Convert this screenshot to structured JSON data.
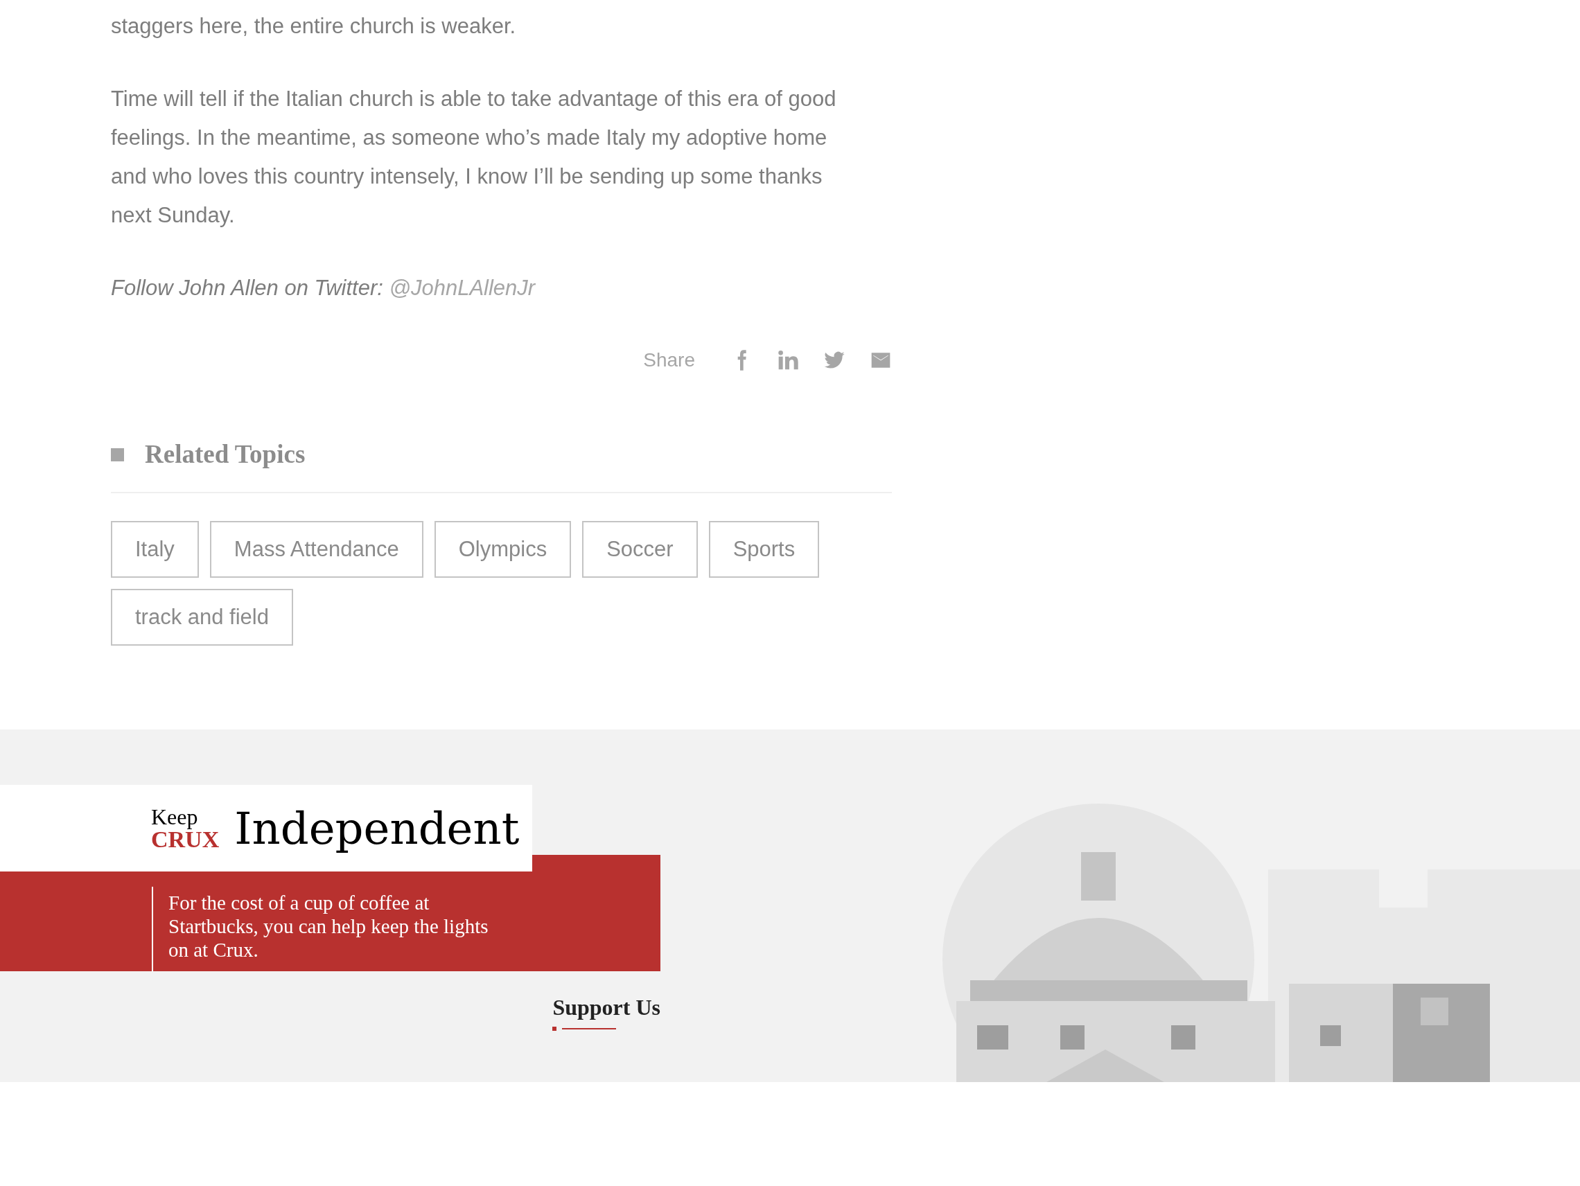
{
  "article": {
    "paragraphs": [
      "staggers here, the entire church is weaker.",
      "Time will tell if the Italian church is able to take advantage of this era of good feelings. In the meantime, as someone who’s made Italy my adoptive home and who loves this country intensely, I know I’ll be sending up some thanks next Sunday."
    ],
    "follow": {
      "text": "Follow John Allen on Twitter:",
      "handle": "@JohnLAllenJr"
    }
  },
  "share": {
    "label": "Share"
  },
  "related_topics": {
    "title": "Related Topics",
    "tags": [
      "Italy",
      "Mass Attendance",
      "Olympics",
      "Soccer",
      "Sports",
      "track and field"
    ]
  },
  "promo": {
    "keep": "Keep",
    "brand": "CRUX",
    "headline": "Independent",
    "body": "For the cost of a cup of coffee at Startbucks, you can help keep the lights on at Crux.",
    "link": "Support Us"
  }
}
